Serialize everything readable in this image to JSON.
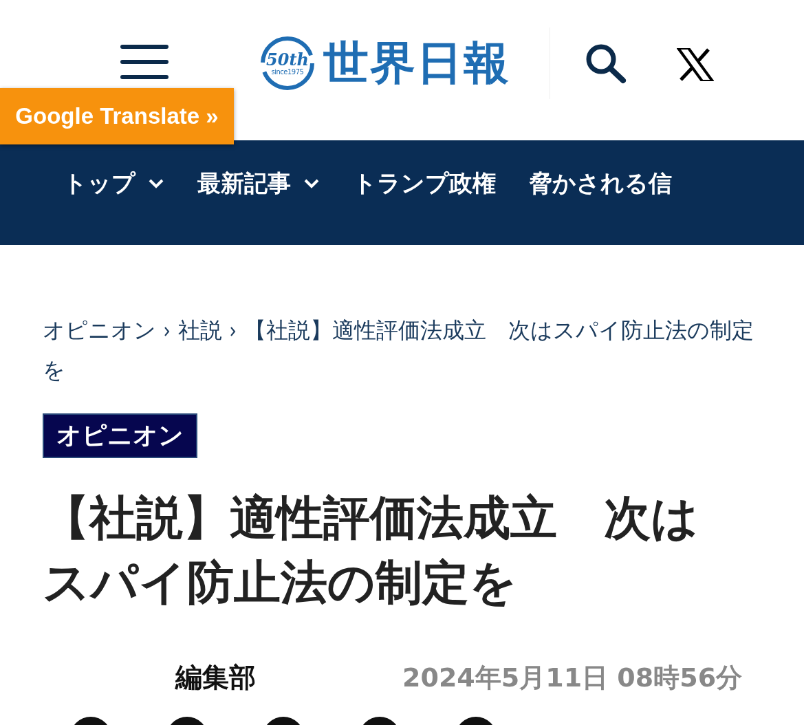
{
  "header": {
    "logo": {
      "badge": "50th",
      "since": "since1975",
      "name": "世界日報"
    },
    "translate_button": "Google Translate »"
  },
  "nav": [
    {
      "label": "トップ",
      "has_dropdown": true
    },
    {
      "label": "最新記事",
      "has_dropdown": true
    },
    {
      "label": "トランプ政権",
      "has_dropdown": false
    },
    {
      "label": "脅かされる信",
      "has_dropdown": false
    }
  ],
  "breadcrumb": [
    "オピニオン",
    "社説",
    "【社説】適性評価法成立　次はスパイ防止法の制定を"
  ],
  "category_tag": "オピニオン",
  "title": "【社説】適性評価法成立　次はスパイ防止法の制定を",
  "author": "編集部",
  "date": "2024年5月11日 08時56分",
  "share_buttons": [
    {
      "kind": "circle"
    },
    {
      "kind": "circle"
    },
    {
      "kind": "circle"
    },
    {
      "kind": "circle"
    },
    {
      "kind": "circle"
    }
  ]
}
